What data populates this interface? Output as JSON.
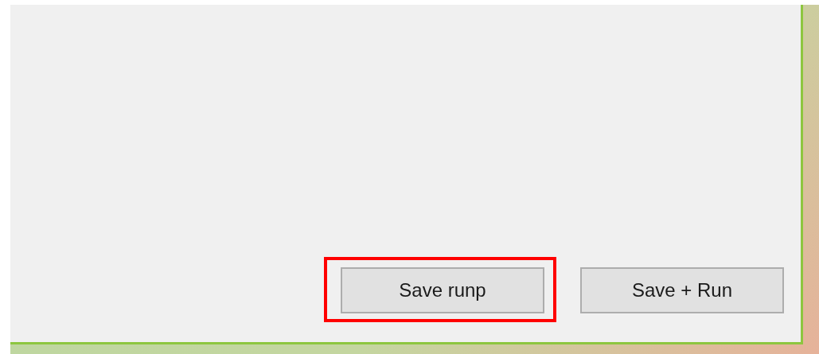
{
  "buttons": [
    {
      "label": "Save runp",
      "highlighted": true
    },
    {
      "label": "Save + Run",
      "highlighted": false
    }
  ]
}
